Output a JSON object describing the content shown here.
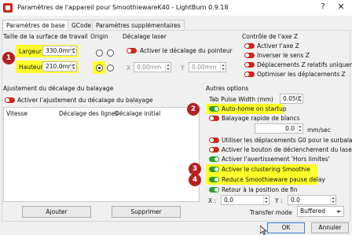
{
  "window": {
    "title": "Paramètres de l'appareil pour SmoothiewareK40 - LightBurn 0.9.18",
    "help": "?",
    "close": "✕"
  },
  "tabs": [
    {
      "label": "Paramètres de base"
    },
    {
      "label": "GCode"
    },
    {
      "label": "Paramètres supplémentaires"
    }
  ],
  "bed": {
    "title": "Taille de la surface de travail",
    "width_label": "Largeur",
    "width_value": "330.0mm",
    "height_label": "Hauteur",
    "height_value": "210.0mm"
  },
  "origin": {
    "title": "Origin",
    "selected": "bottom-left"
  },
  "laser_offset": {
    "title": "Décalage laser",
    "enable_label": "Activer le décalage du pointeur",
    "x_label": "X",
    "x_value": "0.00mm",
    "y_label": "Y",
    "y_value": "0.00mm"
  },
  "z_axis": {
    "title": "Contrôle de l'axe Z",
    "items": [
      {
        "label": "Activer l'axe Z",
        "on": false
      },
      {
        "label": "Inverser le sens Z",
        "on": false
      },
      {
        "label": "Déplacements Z relatifs uniquement",
        "on": false
      },
      {
        "label": "Optimiser les déplacements Z",
        "on": false
      }
    ]
  },
  "scan_offset": {
    "title": "Ajustement du décalage du balayage",
    "enable_label": "Activer l'ajustement du décalage du balayage",
    "columns": [
      "Vitesse",
      "Décalage des lignes",
      "Décalage initial"
    ],
    "add_button": "Ajouter",
    "remove_button": "Supprimer"
  },
  "other": {
    "title": "Autres options",
    "tab_pulse_label": "Tab Pulse Width (mm)",
    "tab_pulse_value": "0.050",
    "auto_home": "Auto-home on startup",
    "fast_whitespace": "Balayage rapide de blancs",
    "speed_value": "0.0",
    "speed_unit": "mm/sec",
    "g0_moves": "Utiliser les déplacements G0 pour le surbalayage",
    "fire_button": "Activer le bouton de déclenchement du laser",
    "soft_limits": "Activer l'avertissement 'Hors limites'",
    "clustering": "Activer le clustering Smoothie",
    "pause_delay": "Reduce Smoothieware pause delay",
    "return_home": "Retour à la position de fin",
    "x_label": "X :",
    "x_value": "0.0",
    "y_label": "Y :",
    "y_value": "0.0",
    "transfer_label": "Transfer mode",
    "transfer_value": "Buffered"
  },
  "badges": [
    "1",
    "2",
    "3",
    "4"
  ],
  "footer": {
    "ok": "OK",
    "cancel": "Annuler"
  },
  "colors": {
    "toggle_off": "#c8291d",
    "toggle_on": "#2aa02a",
    "highlight": "#ffff2b",
    "badge": "#b62020"
  }
}
